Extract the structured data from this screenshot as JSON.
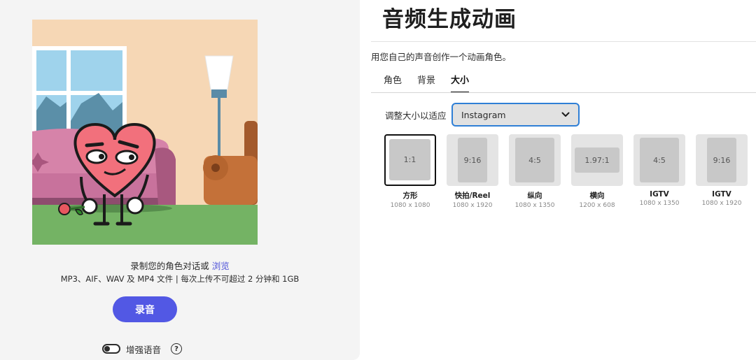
{
  "page": {
    "title": "音频生成动画",
    "subtitle": "用您自己的声音创作一个动画角色。"
  },
  "tabs": [
    {
      "label": "角色",
      "active": false
    },
    {
      "label": "背景",
      "active": false
    },
    {
      "label": "大小",
      "active": true
    }
  ],
  "resize": {
    "label": "调整大小以适应",
    "selected_option": "Instagram"
  },
  "ratios": [
    {
      "ratio": "1:1",
      "name": "方形",
      "size": "1080 x 1080",
      "selected": true
    },
    {
      "ratio": "9:16",
      "name": "快拍/Reel",
      "size": "1080 x 1920",
      "selected": false
    },
    {
      "ratio": "4:5",
      "name": "纵向",
      "size": "1080 x 1350",
      "selected": false
    },
    {
      "ratio": "1.97:1",
      "name": "横向",
      "size": "1200 x 608",
      "selected": false
    },
    {
      "ratio": "4:5",
      "name": "IGTV",
      "size": "1080 x 1350",
      "selected": false
    },
    {
      "ratio": "9:16",
      "name": "IGTV",
      "size": "1080 x 1920",
      "selected": false
    }
  ],
  "upload": {
    "prompt": "录制您的角色对话或",
    "browse_link": "浏览",
    "formats": "MP3、AIF、WAV 及 MP4 文件 | 每次上传不可超过 2 分钟和 1GB"
  },
  "record_button": "录音",
  "enhance": {
    "label": "增强语音",
    "enabled": false,
    "help_glyph": "?"
  },
  "icons": {
    "dropdown": "chevron-down-icon",
    "help": "help-circle-icon",
    "toggle": "toggle-switch"
  },
  "colors": {
    "accent": "#5258e4",
    "link": "#4b4fd8",
    "focus_border": "#2f7fd6",
    "panel_bg": "#f4f4f4"
  }
}
